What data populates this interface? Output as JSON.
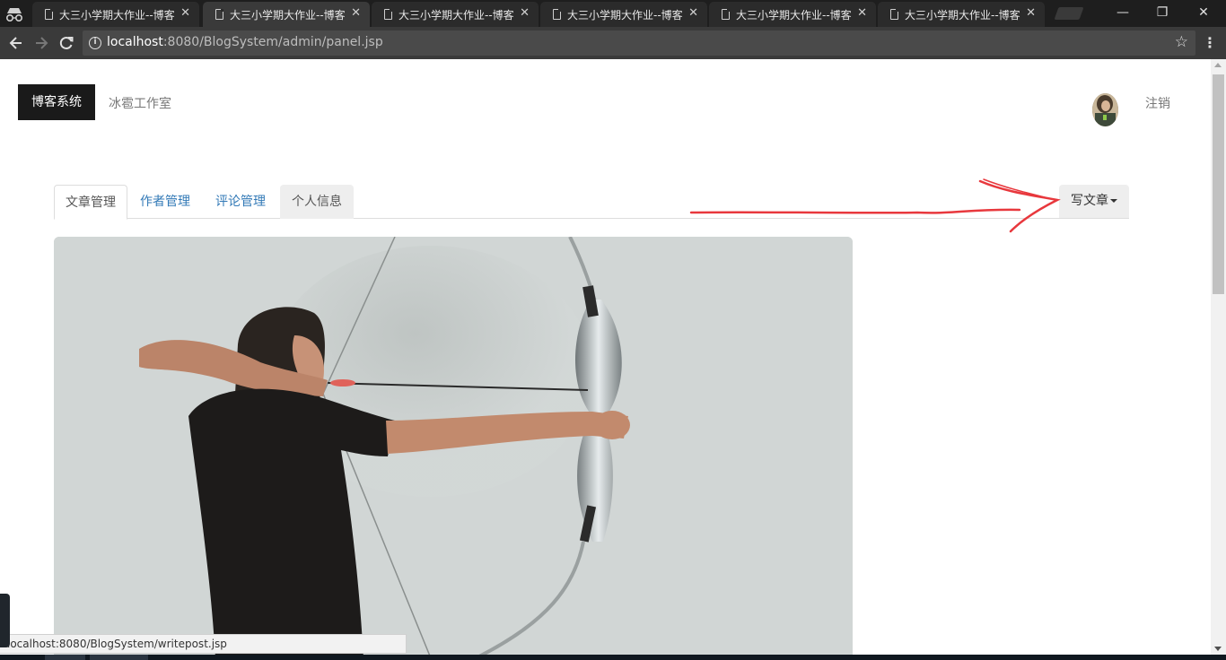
{
  "browser": {
    "tabs": [
      {
        "title": "大三小学期大作业--博客"
      },
      {
        "title": "大三小学期大作业--博客"
      },
      {
        "title": "大三小学期大作业--博客"
      },
      {
        "title": "大三小学期大作业--博客"
      },
      {
        "title": "大三小学期大作业--博客"
      },
      {
        "title": "大三小学期大作业--博客"
      }
    ],
    "active_tab_index": 1,
    "window_controls": {
      "minimize": "—",
      "restore": "❐",
      "close": "✕"
    },
    "url_host": "localhost",
    "url_rest": ":8080/BlogSystem/admin/panel.jsp",
    "status_url": "localhost:8080/BlogSystem/writepost.jsp"
  },
  "header": {
    "brand": "博客系统",
    "studio": "冰雹工作室",
    "logout": "注销"
  },
  "nav_tabs": [
    {
      "label": "文章管理",
      "state": "active"
    },
    {
      "label": "作者管理",
      "state": "link"
    },
    {
      "label": "评论管理",
      "state": "link"
    },
    {
      "label": "个人信息",
      "state": "hover"
    }
  ],
  "write_button": {
    "label": "写文章"
  },
  "annotation": {
    "color": "#e8383d"
  },
  "colors": {
    "brand_bg": "#1a1a1a",
    "link": "#337ab7",
    "chrome_dark": "#1e1e1e",
    "chrome_toolbar": "#3a3a3a"
  }
}
